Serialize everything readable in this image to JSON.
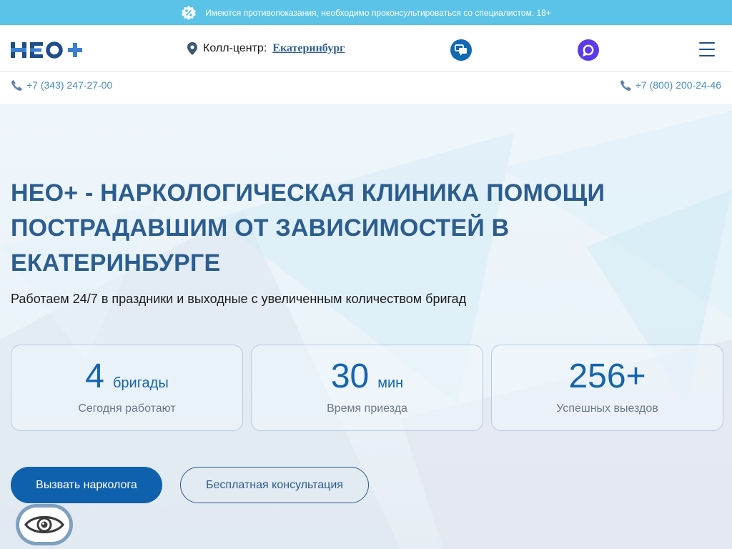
{
  "banner": {
    "text": "Имеются противопоказания, необходимо проконсультироваться со специалистом. 18+",
    "icon": "percent-badge-icon"
  },
  "header": {
    "logo": "НЕО+",
    "callcenter_label": "Колл-центр:",
    "city": "Екатеринбург",
    "phone_left": "+7 (343) 247-27-00",
    "phone_right": "+7 (800) 200-24-46",
    "icons": {
      "location": "location-pin-icon",
      "chat": "chat-icon",
      "messenger": "messenger-icon",
      "menu": "hamburger-menu-icon",
      "phone": "phone-icon"
    }
  },
  "hero": {
    "title": "НЕО+ - НАРКОЛОГИЧЕСКАЯ КЛИНИКА ПОМОЩИ ПОСТРАДАВШИМ ОТ ЗАВИСИМОСТЕЙ В ЕКАТЕРИНБУРГЕ",
    "subtitle": "Работаем 24/7 в праздники и выходные с увеличенным количеством бригад",
    "stats": [
      {
        "value": "4",
        "unit": "бригады",
        "caption": "Сегодня работают"
      },
      {
        "value": "30",
        "unit": "мин",
        "caption": "Время приезда"
      },
      {
        "value": "256+",
        "unit": "",
        "caption": "Успешных выездов"
      }
    ],
    "primary_button": "Вызвать нарколога",
    "secondary_button": "Бесплатная консультация"
  },
  "accessibility": {
    "icon": "eye-icon"
  },
  "colors": {
    "banner": "#5cc3e8",
    "brand_dark": "#1f4d8a",
    "title": "#2c5d8f",
    "accent": "#1565ad",
    "primary_button": "#0f61ad",
    "messenger": "#5b3be8"
  }
}
